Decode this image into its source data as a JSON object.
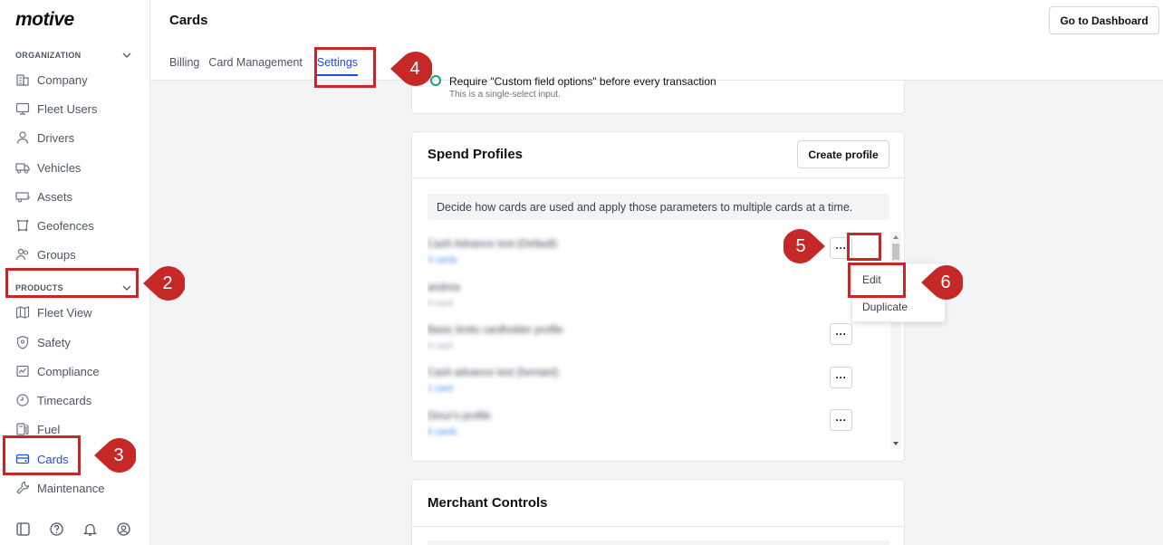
{
  "brand": {
    "logo_text": "motive"
  },
  "sidebar": {
    "organization_label": "ORGANIZATION",
    "products_label": "PRODUCTS",
    "org_items": [
      {
        "label": "Company",
        "icon": "building-icon"
      },
      {
        "label": "Fleet Users",
        "icon": "monitor-icon"
      },
      {
        "label": "Drivers",
        "icon": "person-icon"
      },
      {
        "label": "Vehicles",
        "icon": "truck-icon"
      },
      {
        "label": "Assets",
        "icon": "trailer-icon"
      },
      {
        "label": "Geofences",
        "icon": "geofence-icon"
      },
      {
        "label": "Groups",
        "icon": "group-icon"
      }
    ],
    "product_items": [
      {
        "label": "Fleet View",
        "icon": "map-icon"
      },
      {
        "label": "Safety",
        "icon": "shield-icon"
      },
      {
        "label": "Compliance",
        "icon": "compliance-icon"
      },
      {
        "label": "Timecards",
        "icon": "clock-icon"
      },
      {
        "label": "Fuel",
        "icon": "fuel-icon"
      },
      {
        "label": "Cards",
        "icon": "card-icon",
        "active": true
      },
      {
        "label": "Maintenance",
        "icon": "wrench-icon"
      }
    ]
  },
  "header": {
    "title": "Cards",
    "dashboard_button": "Go to Dashboard",
    "tabs": [
      "Billing",
      "Card Management",
      "Settings"
    ],
    "active_tab": "Settings"
  },
  "custom_field": {
    "label": "Require \"Custom field options\" before every transaction",
    "sublabel": "This is a single-select input."
  },
  "spend_profiles": {
    "title": "Spend Profiles",
    "create_button": "Create profile",
    "info": "Decide how cards are used and apply those parameters to multiple cards at a time.",
    "profiles": [
      {
        "name": "Cash Advance test (Default)",
        "count": "4 cards",
        "link": true
      },
      {
        "name": "andrea",
        "count": "0 card",
        "link": false
      },
      {
        "name": "Basic limits cardholder profile",
        "count": "0 card",
        "link": false
      },
      {
        "name": "Cash advance test (hemant)",
        "count": "1 card",
        "link": true
      },
      {
        "name": "Dinur's profile",
        "count": "6 cards",
        "link": true
      }
    ],
    "menu": [
      "Edit",
      "Duplicate"
    ]
  },
  "merchant_controls": {
    "title": "Merchant Controls"
  },
  "annotations": [
    "2",
    "3",
    "4",
    "5",
    "6"
  ],
  "colors": {
    "accent": "#1d4ed8",
    "annotation": "#c62828"
  }
}
